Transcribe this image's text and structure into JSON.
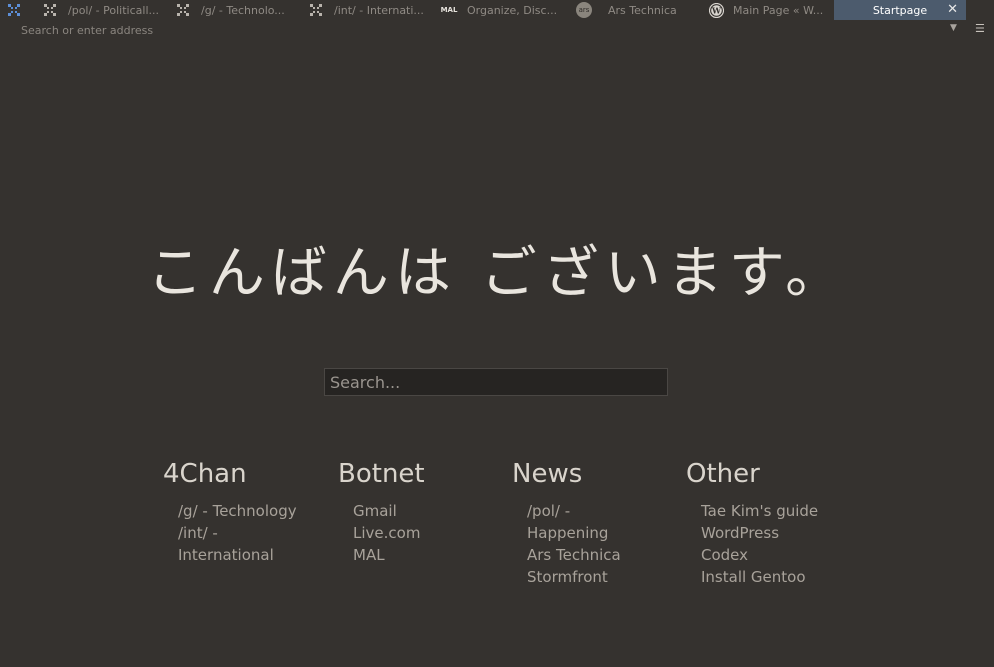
{
  "tabs": [
    {
      "label": "",
      "icon": "fourchan-icon"
    },
    {
      "label": "/pol/ - Politicall...",
      "icon": "fourchan-icon"
    },
    {
      "label": "/g/ - Technolo...",
      "icon": "fourchan-icon"
    },
    {
      "label": "/int/ - Internati...",
      "icon": "fourchan-icon"
    },
    {
      "label": "Organize, Disc...",
      "icon": "mal-icon",
      "icon_text": "MAL"
    },
    {
      "label": "Ars Technica",
      "icon": "ars-icon",
      "icon_text": "ars"
    },
    {
      "label": "Main Page « W...",
      "icon": "wordpress-icon"
    },
    {
      "label": "Startpage",
      "active": true
    }
  ],
  "tab_close_glyph": "✕",
  "address": {
    "placeholder": "Search or enter address"
  },
  "greeting": "こんばんは ございます。",
  "search": {
    "placeholder": "Search..."
  },
  "columns": [
    {
      "title": "4Chan",
      "links": [
        "/g/ - Technology",
        "/int/ - International"
      ]
    },
    {
      "title": "Botnet",
      "links": [
        "Gmail",
        "Live.com",
        "MAL"
      ]
    },
    {
      "title": "News",
      "links": [
        "/pol/ - Happening",
        "Ars Technica",
        "Stormfront"
      ]
    },
    {
      "title": "Other",
      "links": [
        "Tae Kim's guide",
        "WordPress Codex",
        "Install Gentoo"
      ]
    }
  ],
  "colors": {
    "background": "#35322f",
    "active_tab": "#4c5b6d",
    "heading": "#d9d4cc",
    "link": "#a8a29a"
  }
}
